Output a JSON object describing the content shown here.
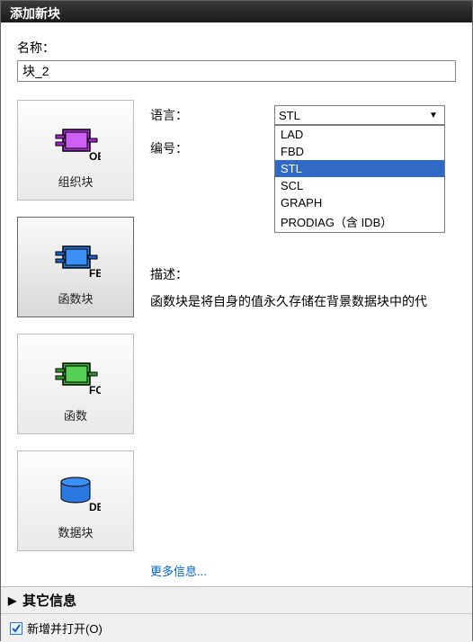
{
  "window": {
    "title": "添加新块"
  },
  "name": {
    "label": "名称：",
    "value": "块_2"
  },
  "blocks": [
    {
      "label": "组织块",
      "tag": "OB",
      "color": "#b030d8"
    },
    {
      "label": "函数块",
      "tag": "FB",
      "color": "#2a7ae2"
    },
    {
      "label": "函数",
      "tag": "FC",
      "color": "#3eb23e"
    },
    {
      "label": "数据块",
      "tag": "DB",
      "color": "#2a7ae2"
    }
  ],
  "details": {
    "language_label": "语言：",
    "number_label": "编号：",
    "selected_language": "STL",
    "language_options": [
      "LAD",
      "FBD",
      "STL",
      "SCL",
      "GRAPH",
      "PRODIAG（含 IDB）"
    ],
    "desc_label": "描述：",
    "desc_text": "函数块是将自身的值永久存储在背景数据块中的代",
    "more_link": "更多信息..."
  },
  "footer": {
    "other_info": "其它信息",
    "open_check_label": "新增并打开(O)"
  }
}
